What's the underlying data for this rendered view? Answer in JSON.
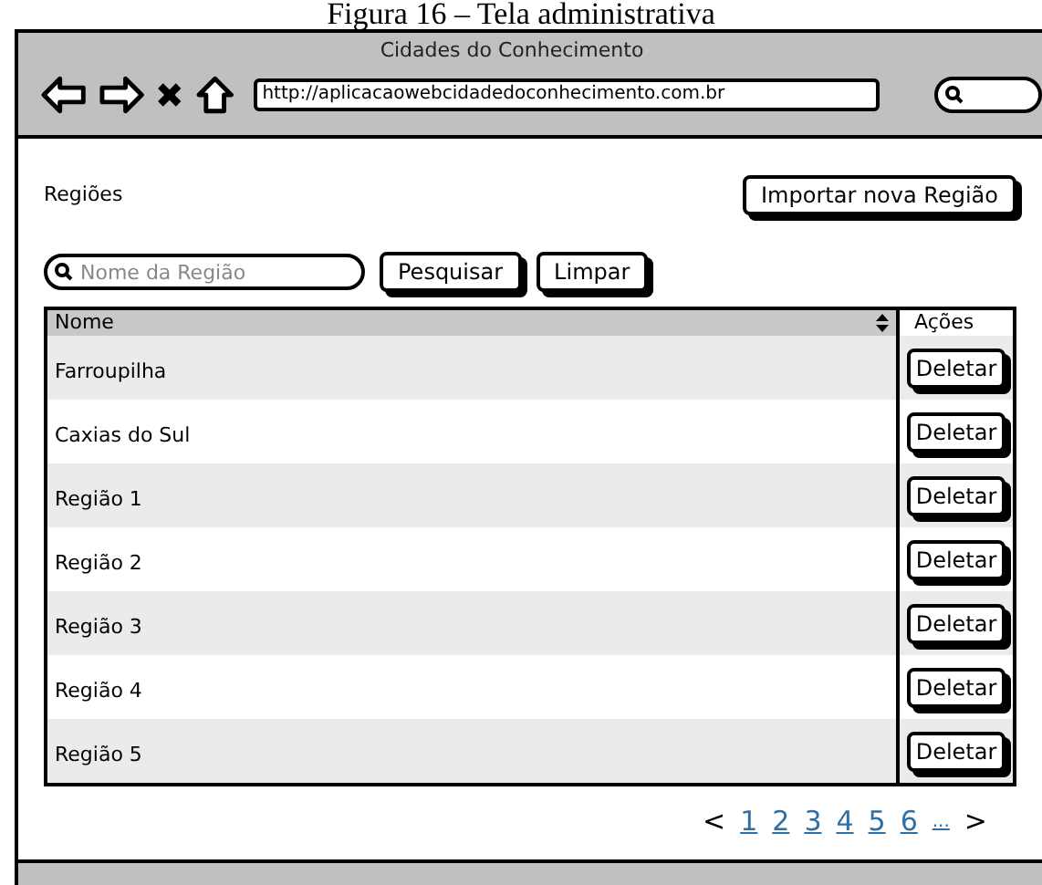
{
  "caption": "Figura 16 – Tela administrativa",
  "window": {
    "title": "Cidades do Conhecimento",
    "url": "http://aplicacaowebcidadedoconhecimento.com.br"
  },
  "page": {
    "heading": "Regiões",
    "import_button": "Importar nova Região"
  },
  "search": {
    "placeholder": "Nome da Região",
    "buttons": [
      "Pesquisar",
      "Limpar"
    ]
  },
  "table": {
    "columns": [
      "Nome",
      "Ações"
    ],
    "rows": [
      {
        "name": "Farroupilha",
        "action": "Deletar"
      },
      {
        "name": "Caxias do Sul",
        "action": "Deletar"
      },
      {
        "name": "Região 1",
        "action": "Deletar"
      },
      {
        "name": "Região 2",
        "action": "Deletar"
      },
      {
        "name": "Região 3",
        "action": "Deletar"
      },
      {
        "name": "Região 4",
        "action": "Deletar"
      },
      {
        "name": "Região 5",
        "action": "Deletar"
      }
    ]
  },
  "pagination": {
    "prev": "<",
    "pages": [
      "1",
      "2",
      "3",
      "4",
      "5",
      "6",
      "..."
    ],
    "next": ">"
  }
}
